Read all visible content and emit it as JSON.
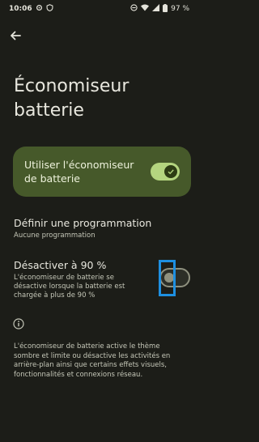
{
  "status_bar": {
    "time": "10:06",
    "battery_percent": "97 %",
    "left_icons": [
      "settings-icon",
      "shield-icon"
    ],
    "right_icons": [
      "dnd-icon",
      "wifi-icon",
      "signal-icon",
      "battery-icon"
    ]
  },
  "header": {
    "title": "Économiseur batterie"
  },
  "main_toggle": {
    "label": "Utiliser l'économiseur de batterie",
    "on": true
  },
  "schedule": {
    "title": "Définir une programmation",
    "subtitle": "Aucune programmation"
  },
  "auto_off": {
    "title": "Désactiver à 90 %",
    "subtitle": "L'économiseur de batterie se désactive lorsque la batterie est chargée à plus de 90 %",
    "on": false
  },
  "footer": {
    "text": "L'économiseur de batterie active le thème sombre et limite ou désactive les activités en arrière-plan ainsi que certains effets visuels, fonctionnalités et connexions réseau."
  },
  "colors": {
    "background": "#1c1d18",
    "card": "#46592a",
    "accent": "#b4d57f",
    "focus": "#1e8fe0"
  }
}
